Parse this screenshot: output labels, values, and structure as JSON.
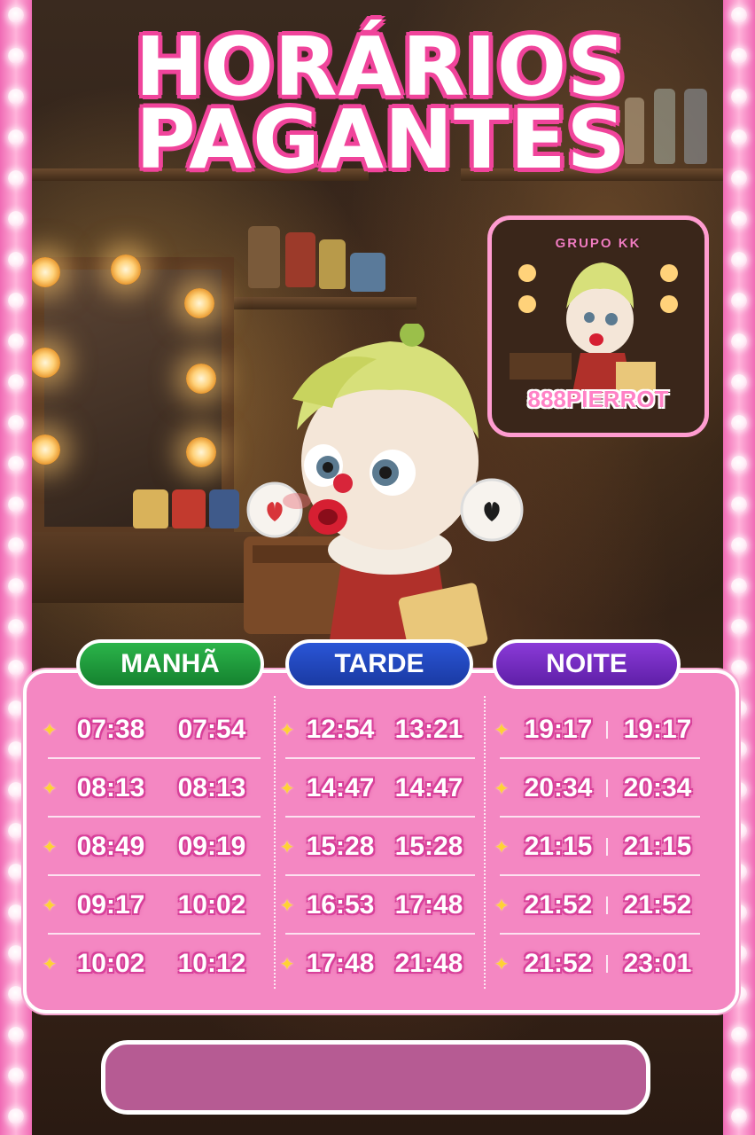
{
  "title": {
    "line1": "HORÁRIOS",
    "line2": "PAGANTES"
  },
  "logo": {
    "group": "GRUPO KK",
    "brand": "888PIERROT"
  },
  "schedule": {
    "manha": {
      "label": "MANHÃ",
      "rows": [
        [
          "07:38",
          "07:54"
        ],
        [
          "08:13",
          "08:13"
        ],
        [
          "08:49",
          "09:19"
        ],
        [
          "09:17",
          "10:02"
        ],
        [
          "10:02",
          "10:12"
        ]
      ]
    },
    "tarde": {
      "label": "TARDE",
      "rows": [
        [
          "12:54",
          "13:21"
        ],
        [
          "14:47",
          "14:47"
        ],
        [
          "15:28",
          "15:28"
        ],
        [
          "16:53",
          "17:48"
        ],
        [
          "17:48",
          "21:48"
        ]
      ]
    },
    "noite": {
      "label": "NOITE",
      "rows": [
        [
          "19:17",
          "19:17"
        ],
        [
          "20:34",
          "20:34"
        ],
        [
          "21:15",
          "21:15"
        ],
        [
          "21:52",
          "21:52"
        ],
        [
          "21:52",
          "23:01"
        ]
      ]
    }
  },
  "colors": {
    "pink_panel": "#f487c2",
    "title_outline": "#f0449b",
    "manha": "#2bb44a",
    "tarde": "#2a55d6",
    "noite": "#8a3ad8",
    "bottom_bar": "#b65b93"
  },
  "icons": {
    "row_marker": "sparkle-star-icon"
  }
}
